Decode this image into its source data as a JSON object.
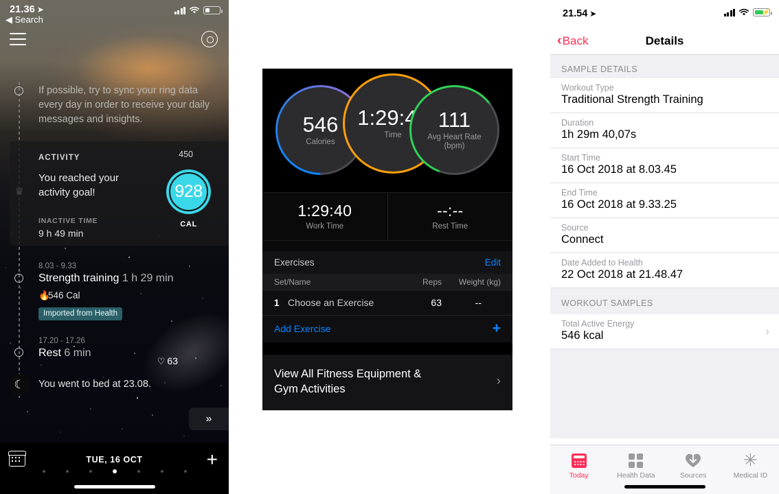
{
  "panel1": {
    "status": {
      "time": "21.36",
      "location_icon": "location-arrow-icon",
      "back_label": "◀ Search"
    },
    "nav": {
      "menu_icon": "hamburger-menu-icon",
      "ring_icon": "ring-device-icon"
    },
    "message": "If possible, try to sync your ring data every day in order to receive your daily messages and insights.",
    "activity_card": {
      "label": "ACTIVITY",
      "headline": "You reached your activity goal!",
      "inactive_label": "INACTIVE TIME",
      "inactive_value": "9 h 49 min",
      "goal_target": "450",
      "goal_value": "928",
      "goal_unit": "CAL",
      "accent": "#3ad7e8"
    },
    "events": [
      {
        "time": "8.03 - 9.33",
        "title": "Strength training",
        "duration": "1 h 29 min",
        "calories": "546 Cal",
        "badge": "Imported from Health",
        "icon": "flame-icon",
        "node_icon": "crown-icon"
      },
      {
        "time": "17.20 - 17.26",
        "title": "Rest",
        "duration": "6 min",
        "heart_rate": "63",
        "heart_icon": "heart-outline-icon",
        "node_icon": "circle-node-icon"
      }
    ],
    "bedtime": "You went to bed at 23.08.",
    "more_button": "»",
    "tabbar": {
      "calendar_icon": "calendar-icon",
      "date": "TUE, 16 OCT",
      "add_icon": "plus-icon",
      "active_dot_index": 3,
      "dot_count": 7
    }
  },
  "panel2": {
    "metrics": [
      {
        "value": "546",
        "label": "Calories",
        "ring_color": "#0a84ff",
        "name": "calories-circle"
      },
      {
        "value": "1:29:40",
        "label": "Time",
        "ring_color": "#ff9f0a",
        "name": "time-circle"
      },
      {
        "value": "111",
        "label": "Avg Heart Rate (bpm)",
        "label_line1": "Avg Heart Rate",
        "label_line2": "(bpm)",
        "ring_color": "#30d158",
        "name": "heart-rate-circle"
      }
    ],
    "work_rest": [
      {
        "value": "1:29:40",
        "label": "Work Time"
      },
      {
        "value": "--:--",
        "label": "Rest Time"
      }
    ],
    "exercises": {
      "title": "Exercises",
      "edit_label": "Edit",
      "columns": {
        "name": "Set/Name",
        "reps": "Reps",
        "weight": "Weight (kg)"
      },
      "rows": [
        {
          "set": "1",
          "name": "Choose an Exercise",
          "reps": "63",
          "weight": "--"
        }
      ],
      "add_label": "Add Exercise",
      "add_icon": "plus-icon"
    },
    "view_all": {
      "line1": "View All Fitness Equipment &",
      "line2": "Gym Activities",
      "chevron": "›"
    }
  },
  "panel3": {
    "status": {
      "time": "21.54",
      "location_icon": "location-arrow-icon"
    },
    "nav": {
      "back_label": "Back",
      "back_chevron": "‹",
      "title": "Details",
      "accent": "#ff2d55"
    },
    "sections": [
      {
        "header": "SAMPLE DETAILS",
        "rows": [
          {
            "key": "Workout Type",
            "value": "Traditional Strength Training"
          },
          {
            "key": "Duration",
            "value": "1h 29m 40,07s"
          },
          {
            "key": "Start Time",
            "value": "16 Oct 2018 at 8.03.45"
          },
          {
            "key": "End Time",
            "value": "16 Oct 2018 at 9.33.25"
          },
          {
            "key": "Source",
            "value": "Connect"
          },
          {
            "key": "Date Added to Health",
            "value": "22 Oct 2018 at 21.48.47"
          }
        ]
      },
      {
        "header": "WORKOUT SAMPLES",
        "rows": [
          {
            "key": "Total Active Energy",
            "value": "546 kcal",
            "arrow": "›"
          }
        ]
      }
    ],
    "tabs": [
      {
        "label": "Today",
        "icon": "today-calendar-icon",
        "active": true
      },
      {
        "label": "Health Data",
        "icon": "grid-icon",
        "active": false
      },
      {
        "label": "Sources",
        "icon": "heart-download-icon",
        "active": false
      },
      {
        "label": "Medical ID",
        "icon": "medical-asterisk-icon",
        "active": false
      }
    ]
  }
}
